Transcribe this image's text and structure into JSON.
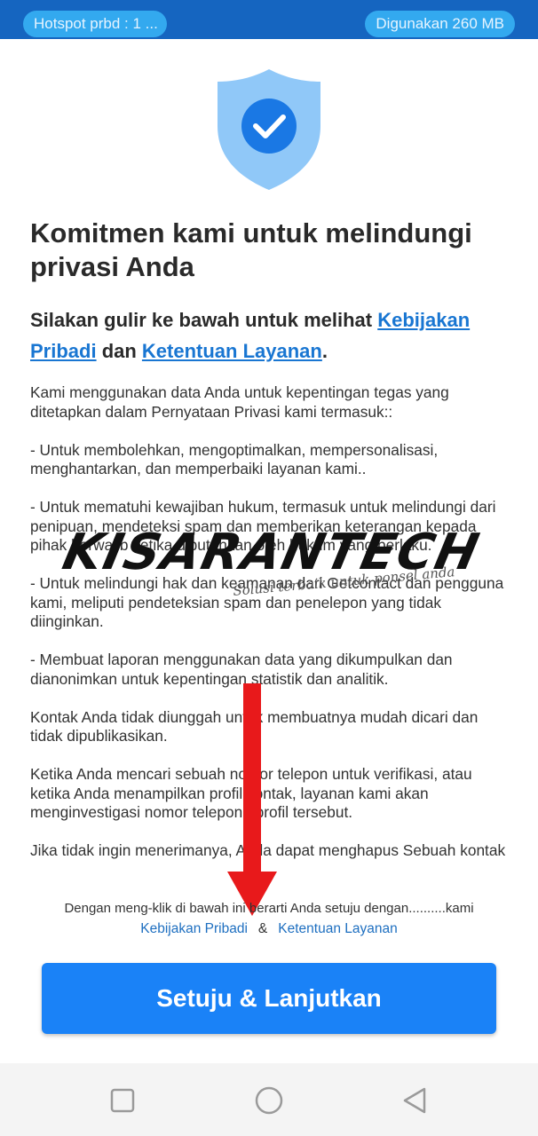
{
  "status_bar": {
    "hotspot": "Hotspot prbd : 1 ...",
    "usage": "Digunakan 260 MB"
  },
  "header": {
    "icon": "shield-check-icon",
    "title": "Komitmen kami untuk melindungi privasi Anda"
  },
  "subtitle": {
    "prefix": "Silakan gulir ke bawah untuk melihat ",
    "link_privacy": "Kebijakan Pribadi",
    "middle": " dan ",
    "link_terms": "Ketentuan Layanan",
    "suffix": "."
  },
  "body": {
    "paragraphs": [
      "Kami menggunakan data Anda untuk kepentingan tegas yang ditetapkan dalam Pernyataan Privasi kami termasuk::",
      "- Untuk membolehkan, mengoptimalkan, mempersonalisasi, menghantarkan, dan memperbaiki layanan kami..",
      "- Untuk mematuhi kewajiban hukum, termasuk untuk melindungi dari penipuan, mendeteksi spam dan memberikan keterangan kepada pihak berwajib ketika dibutuhkan oleh hukum yang berlaku.",
      "- Untuk melindungi hak dan keamanan dari Getcontact dan pengguna kami, meliputi pendeteksian spam dan penelepon yang tidak diinginkan.",
      "- Membuat laporan menggunakan data yang dikumpulkan dan dianonimkan untuk kepentingan statistik dan analitik.",
      "Kontak Anda tidak diunggah untuk membuatnya mudah dicari dan tidak dipublikasikan.",
      "Ketika Anda mencari sebuah nomor telepon untuk verifikasi, atau ketika Anda menampilkan profil kontak, layanan kami akan menginvestigasi nomor telepon / profil tersebut.",
      "Jika tidak ingin menerimanya, Anda dapat menghapus Sebuah kontak"
    ]
  },
  "agreement": {
    "text": "Dengan meng-klik di bawah ini berarti Anda setuju dengan..........kami",
    "link_privacy": "Kebijakan Pribadi",
    "amp": "&",
    "link_terms": "Ketentuan Layanan"
  },
  "cta": {
    "label": "Setuju & Lanjutkan"
  },
  "watermark": {
    "main": "KISARANTECH",
    "sub": "Solusi terbaik untuk ponsel anda"
  },
  "nav": {
    "recent": "square-icon",
    "home": "circle-icon",
    "back": "triangle-back-icon"
  },
  "colors": {
    "status_bar": "#1565c0",
    "link": "#1976d2",
    "button": "#1a82f7",
    "shield": "#90c8f8",
    "arrow": "#e8191b"
  }
}
